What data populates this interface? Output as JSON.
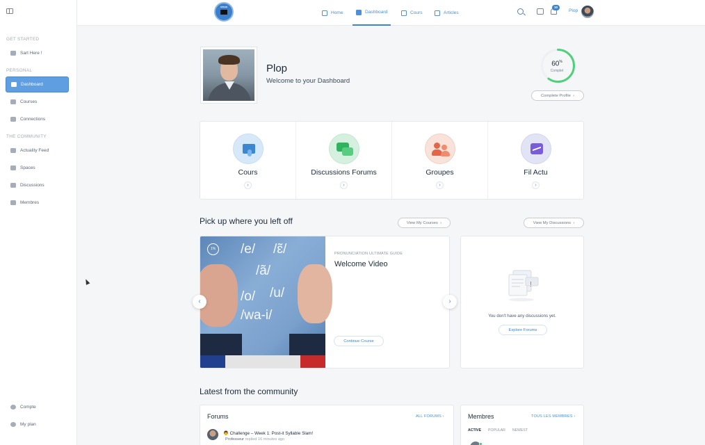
{
  "sidebar": {
    "sections": {
      "get_started": "GET STARTED",
      "personal": "PERSONAL",
      "community": "THE COMMUNITY"
    },
    "items": [
      {
        "label": "Sart Here !",
        "icon": "megaphone-icon"
      },
      {
        "label": "Dashboard",
        "icon": "dashboard-icon",
        "active": true
      },
      {
        "label": "Courses",
        "icon": "graduation-cap-icon"
      },
      {
        "label": "Connections",
        "icon": "users-icon"
      },
      {
        "label": "Actuality Feed",
        "icon": "activity-icon"
      },
      {
        "label": "Spaces",
        "icon": "group-icon"
      },
      {
        "label": "Discussions",
        "icon": "chat-icon"
      },
      {
        "label": "Membres",
        "icon": "members-icon"
      }
    ],
    "bottom": [
      {
        "label": "Compte",
        "icon": "gear-icon"
      },
      {
        "label": "My plan",
        "icon": "plan-icon"
      }
    ]
  },
  "topbar": {
    "logo_text": "SPEAK",
    "nav": [
      {
        "label": "Home",
        "icon": "home-icon"
      },
      {
        "label": "Dashboard",
        "icon": "dashboard-icon",
        "active": true
      },
      {
        "label": "Cours",
        "icon": "graduation-cap-icon"
      },
      {
        "label": "Articles",
        "icon": "document-icon"
      }
    ],
    "notification_count": "10",
    "username": "Plop",
    "accent": "#3d84d0"
  },
  "profile": {
    "name": "Plop",
    "welcome": "Welcome to your Dashboard",
    "progress_value": "60",
    "progress_percent": 60,
    "progress_sup": "%",
    "progress_label": "Complet",
    "complete_button": "Complete Profile"
  },
  "quick_links": [
    {
      "label": "Cours",
      "icon": "book-icon",
      "color": "#d7e9f8"
    },
    {
      "label": "Discussions Forums",
      "icon": "forum-icon",
      "color": "#d6f0e0"
    },
    {
      "label": "Groupes",
      "icon": "group-icon",
      "color": "#f8e2da"
    },
    {
      "label": "Fil Actu",
      "icon": "activity-icon",
      "color": "#e2e4f6"
    }
  ],
  "continue": {
    "heading": "Pick up where you left off",
    "view_courses": "View My Courses",
    "view_discussions": "View My Discussions",
    "course": {
      "tag": "PRONUNCIATION ULTIMATE GUIDE",
      "title": "Welcome Video",
      "progress": "1%",
      "button": "Continue Course",
      "phonemes": [
        "/e/",
        "/ɛ̃/",
        "/ã/",
        "/o/",
        "/u/",
        "/wa-i/"
      ]
    },
    "discussions": {
      "empty_text": "You don't have any discussions yet.",
      "button": "Explore Forums"
    }
  },
  "community": {
    "heading": "Latest from the community",
    "forums": {
      "title": "Forums",
      "link": "ALL FORUMS",
      "topic_emoji": "👨",
      "topic_title": "Challenge – Week 1: Post-it Syllable Slam!",
      "author": "Professeur",
      "replied": "replied",
      "time": "16 minutes ago"
    },
    "members": {
      "title": "Membres",
      "link": "TOUS LES MEMBRES",
      "tabs": [
        "ACTIVE",
        "POPULAR",
        "NEWEST"
      ]
    }
  }
}
